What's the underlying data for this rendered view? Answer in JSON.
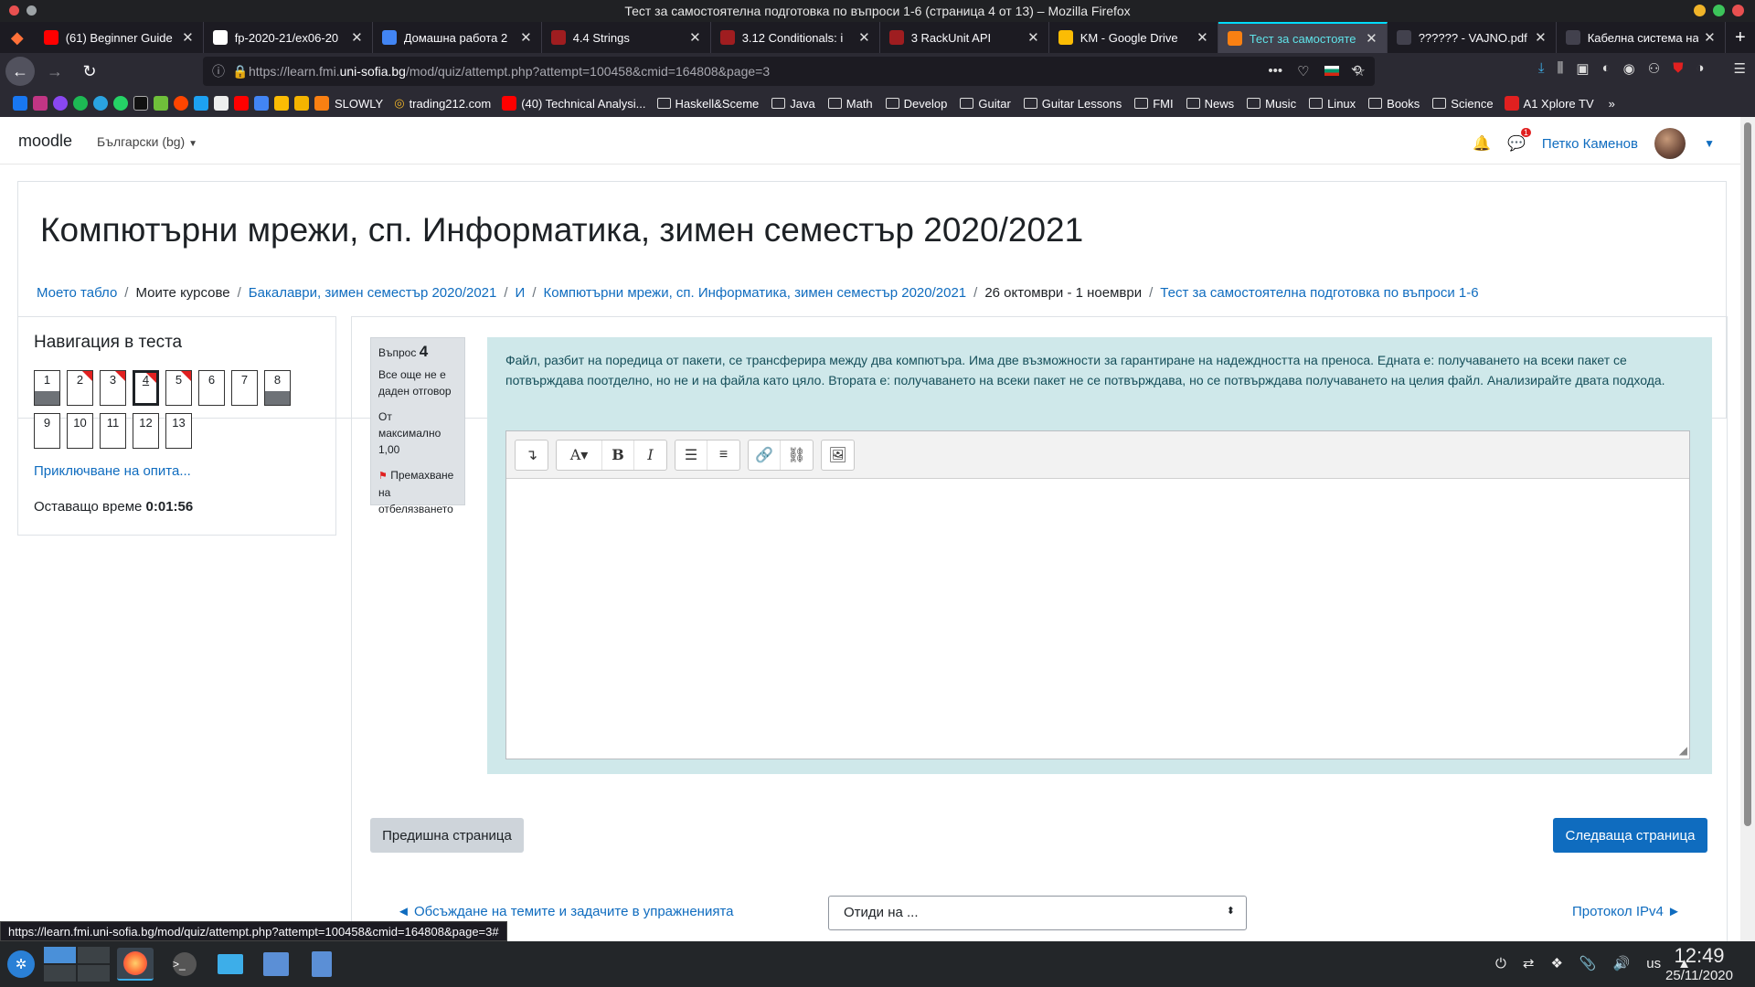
{
  "window": {
    "title": "Тест за самостоятелна подготовка по въпроси 1-6 (страница 4 от 13) – Mozilla Firefox"
  },
  "tabs": [
    {
      "label": "(61) Beginner Guide",
      "icon": "youtube-icon",
      "color": "#ff0000"
    },
    {
      "label": "fp-2020-21/ex06-20",
      "icon": "github-icon",
      "color": "#ffffff"
    },
    {
      "label": "Домашна работа 2",
      "icon": "docs-icon",
      "color": "#4285f4"
    },
    {
      "label": "4.4 Strings",
      "icon": "racket-icon",
      "color": "#9f1d20"
    },
    {
      "label": "3.12 Conditionals: i",
      "icon": "racket-icon",
      "color": "#9f1d20"
    },
    {
      "label": "3 RackUnit API",
      "icon": "racket-icon",
      "color": "#9f1d20"
    },
    {
      "label": "KM - Google Drive",
      "icon": "drive-icon",
      "color": "#fbbc04"
    },
    {
      "label": "Тест за самостояте",
      "icon": "moodle-icon",
      "color": "#f98012",
      "active": true
    },
    {
      "label": "?????? - VAJNO.pdf",
      "icon": "pdf-icon",
      "color": "#42414d"
    },
    {
      "label": "Кабелна система на Л",
      "icon": "pdf-icon",
      "color": "#42414d"
    }
  ],
  "nav": {
    "url_prefix": "https://learn.fmi.",
    "url_domain": "uni-sofia.bg",
    "url_rest": "/mod/quiz/attempt.php?attempt=100458&cmid=164808&page=3"
  },
  "bookmarks": {
    "named": [
      "SLOWLY",
      "trading212.com",
      "(40) Technical Analysi..."
    ],
    "folders": [
      "Haskell&Sceme",
      "Java",
      "Math",
      "Develop",
      "Guitar",
      "Guitar Lessons",
      "FMI",
      "News",
      "Music",
      "Linux",
      "Books",
      "Science"
    ],
    "last": "A1 Xplore TV"
  },
  "header": {
    "brand": "moodle",
    "language": "Български (bg)",
    "user_name": "Петко Каменов",
    "message_count": "1"
  },
  "course": {
    "title": "Компютърни мрежи, сп. Информатика, зимен семестър 2020/2021",
    "breadcrumb": [
      {
        "label": "Моето табло",
        "link": true
      },
      {
        "label": "Моите курсове",
        "link": false
      },
      {
        "label": "Бакалаври, зимен семестър 2020/2021",
        "link": true
      },
      {
        "label": "И",
        "link": true
      },
      {
        "label": "Компютърни мрежи, сп. Информатика, зимен семестър 2020/2021",
        "link": true
      },
      {
        "label": "26 октомври - 1 ноември",
        "link": false
      },
      {
        "label": "Тест за самостоятелна подготовка по въпроси 1-6",
        "link": true
      }
    ]
  },
  "quiz_nav": {
    "title": "Навигация в теста",
    "questions": [
      {
        "n": "1",
        "answered": true,
        "flagged": false
      },
      {
        "n": "2",
        "answered": false,
        "flagged": true
      },
      {
        "n": "3",
        "answered": false,
        "flagged": true
      },
      {
        "n": "4",
        "answered": false,
        "flagged": true,
        "current": true
      },
      {
        "n": "5",
        "answered": false,
        "flagged": true
      },
      {
        "n": "6",
        "answered": false,
        "flagged": false
      },
      {
        "n": "7",
        "answered": false,
        "flagged": false
      },
      {
        "n": "8",
        "answered": true,
        "flagged": false
      },
      {
        "n": "9",
        "answered": false,
        "flagged": false
      },
      {
        "n": "10",
        "answered": false,
        "flagged": false
      },
      {
        "n": "11",
        "answered": false,
        "flagged": false
      },
      {
        "n": "12",
        "answered": false,
        "flagged": false
      },
      {
        "n": "13",
        "answered": false,
        "flagged": false
      }
    ],
    "finish_link": "Приключване на опита...",
    "time_label": "Оставащо време",
    "time_value": "0:01:56"
  },
  "question": {
    "label": "Въпрос",
    "number": "4",
    "status": "Все още не е даден отговор",
    "max_mark": "От максимално 1,00",
    "flag_label": "Премахване на отбелязването",
    "text": "Файл, разбит на поредица от пакети, се трансферира между два компютъра. Има две възможности за гарантиране на надеждността на преноса. Едната е: получаването на всеки пакет се потвърждава поотделно, но не и на файла като цяло. Втората е: получаването на всеки пакет не се потвърждава, но се потвърждава получаването на целия файл. Анализирайте двата подхода."
  },
  "buttons": {
    "prev": "Предишна страница",
    "next": "Следваща страница"
  },
  "activity_nav": {
    "prev": "◄ Обсъждане на темите и задачите в упражненията",
    "jump": "Отиди на ...",
    "next": "Протокол IPv4 ►"
  },
  "status_link": "https://learn.fmi.uni-sofia.bg/mod/quiz/attempt.php?attempt=100458&cmid=164808&page=3#",
  "taskbar": {
    "keyboard_layout": "us",
    "time": "12:49",
    "date": "25/11/2020"
  }
}
